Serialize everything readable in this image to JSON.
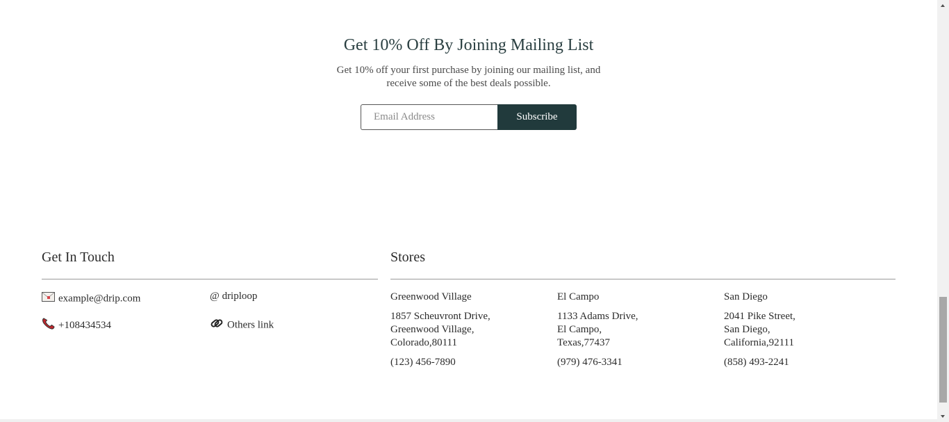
{
  "newsletter": {
    "title": "Get 10% Off By Joining Mailing List",
    "description": "Get 10% off your first purchase by joining our mailing list, and receive some of the best deals possible.",
    "email_placeholder": "Email Address",
    "email_value": "",
    "subscribe_label": "Subscribe"
  },
  "contact": {
    "title": "Get In Touch",
    "email": "example@drip.com",
    "phone": "+108434534",
    "handle": "@ driploop",
    "others_link": "Others link",
    "icons": [
      "envelope-icon",
      "phone-icon",
      "link-icon"
    ]
  },
  "stores": {
    "title": "Stores",
    "items": [
      {
        "name": "Greenwood Village",
        "address": [
          "1857 Scheuvront Drive,",
          "Greenwood Village,",
          "Colorado,80111"
        ],
        "phone": "(123) 456-7890"
      },
      {
        "name": "El Campo",
        "address": [
          "1133 Adams Drive,",
          "El Campo,",
          "Texas,77437"
        ],
        "phone": "(979) 476-3341"
      },
      {
        "name": "San Diego",
        "address": [
          "2041 Pike Street,",
          "San Diego,",
          "California,92111"
        ],
        "phone": "(858) 493-2241"
      }
    ]
  },
  "colors": {
    "accent": "#213a3c",
    "title_text": "#2a3f41",
    "phone_icon": "#c0272d"
  }
}
